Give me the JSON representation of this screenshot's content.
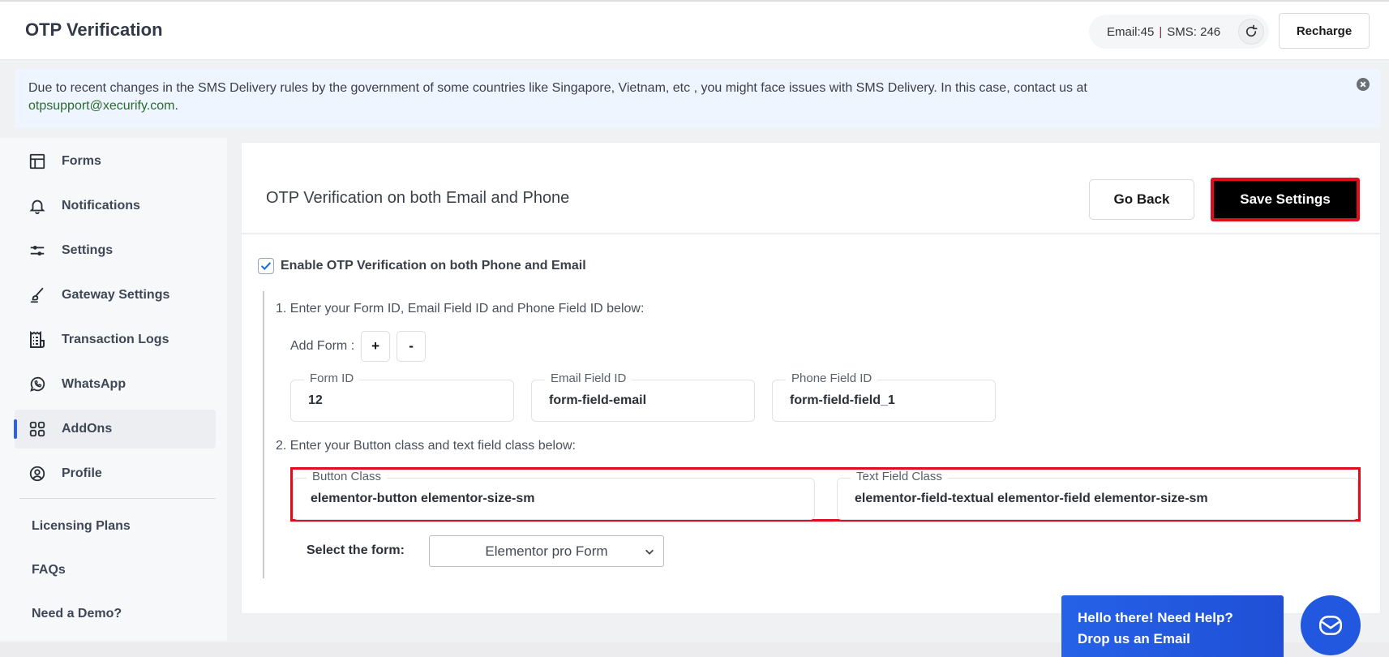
{
  "header": {
    "title": "OTP Verification",
    "credits": {
      "email": "Email:45",
      "sms": "SMS: 246"
    },
    "refresh_icon": "refresh-icon",
    "recharge_label": "Recharge"
  },
  "notice": {
    "text": "Due to recent changes in the SMS Delivery rules by the government of some countries like Singapore, Vietnam, etc , you might face issues with SMS Delivery. In this case, contact us at",
    "email": "otpsupport@xecurify.com",
    "trail": ".",
    "close_icon": "close-circle-icon"
  },
  "sidebar": {
    "items": [
      {
        "label": "Forms",
        "icon": "layout-icon"
      },
      {
        "label": "Notifications",
        "icon": "bell-icon"
      },
      {
        "label": "Settings",
        "icon": "sliders-icon"
      },
      {
        "label": "Gateway Settings",
        "icon": "brush-icon"
      },
      {
        "label": "Transaction Logs",
        "icon": "receipt-icon"
      },
      {
        "label": "WhatsApp",
        "icon": "whatsapp-icon"
      },
      {
        "label": "AddOns",
        "icon": "grid-icon",
        "active": true
      },
      {
        "label": "Profile",
        "icon": "user-circle-icon"
      }
    ],
    "links": [
      "Licensing Plans",
      "FAQs",
      "Need a Demo?"
    ],
    "accent_color": "#2f5fe6"
  },
  "main": {
    "title": "OTP Verification on both Email and Phone",
    "go_back_label": "Go Back",
    "save_label": "Save Settings",
    "enable_label": "Enable OTP Verification on both Phone and Email",
    "enable_checked": true,
    "step1": "1. Enter your Form ID, Email Field ID and Phone Field ID below:",
    "add_form_label": "Add Form :",
    "add_plus": "+",
    "add_minus": "-",
    "fields": {
      "form_id": {
        "label": "Form ID",
        "value": "12"
      },
      "email_field_id": {
        "label": "Email Field ID",
        "value": "form-field-email"
      },
      "phone_field_id": {
        "label": "Phone Field ID",
        "value": "form-field-field_1"
      }
    },
    "step2": "2. Enter your Button class and text field class below:",
    "button_class": {
      "label": "Button Class",
      "value": "elementor-button elementor-size-sm"
    },
    "text_field_class": {
      "label": "Text Field Class",
      "value": "elementor-field-textual elementor-field elementor-size-sm"
    },
    "select_label": "Select the form:",
    "select_value": "Elementor pro Form",
    "highlight_color": "#e10d1c"
  },
  "help": {
    "line1": "Hello there! Need Help?",
    "line2": "Drop us an Email",
    "icon": "mail-icon",
    "color": "#2258e0"
  }
}
